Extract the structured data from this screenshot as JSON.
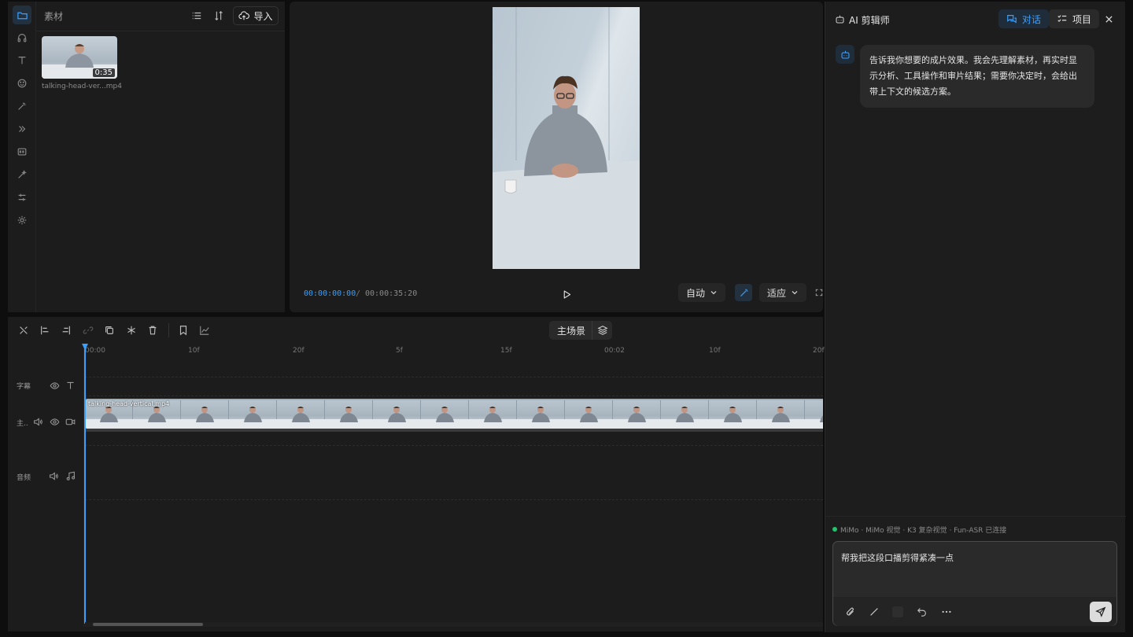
{
  "media_panel": {
    "title": "素材",
    "import_label": "导入",
    "clip": {
      "duration": "0:35",
      "name": "talking-head-ver...mp4"
    }
  },
  "preview": {
    "current_time": "00:00:00:00",
    "separator": "/",
    "total_time": "00:00:35:20",
    "quality_label": "自动",
    "fit_label": "适应"
  },
  "timeline": {
    "scene_label": "主场景",
    "ticks": [
      "00:00",
      "10f",
      "20f",
      "5f",
      "15f",
      "00:02",
      "10f",
      "20f"
    ],
    "tracks": {
      "subtitle_label": "字幕",
      "main_label": "主..",
      "audio_label": "音频"
    },
    "clip_name": "talking-head-vertical.mp4"
  },
  "ai_panel": {
    "title": "AI 剪辑师",
    "tab_chat": "对话",
    "tab_project": "项目",
    "message": "告诉我你想要的成片效果。我会先理解素材，再实时显示分析、工具操作和审片结果；需要你决定时，会给出带上下文的候选方案。",
    "status": "MiMo · MiMo 视觉 · K3 复杂视觉 · Fun-ASR 已连接",
    "input_value": "帮我把这段口播剪得紧凑一点"
  },
  "colors": {
    "accent": "#3aa0ff",
    "online": "#21c36b"
  }
}
